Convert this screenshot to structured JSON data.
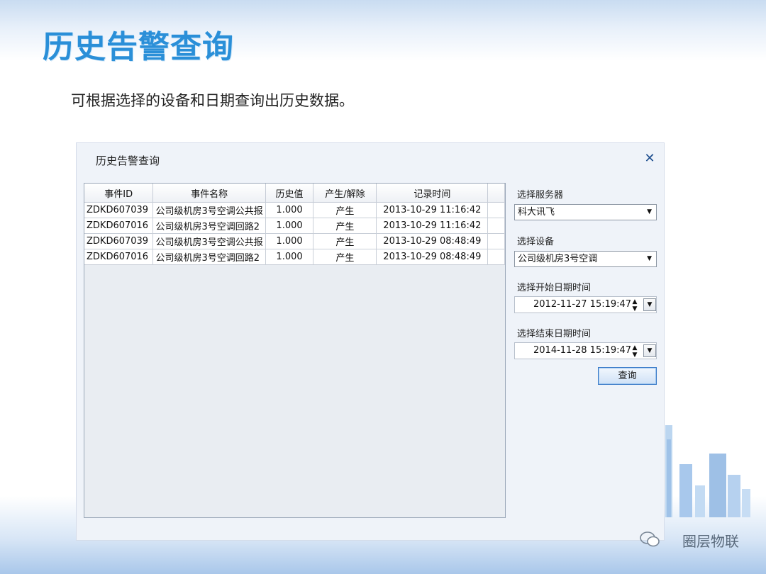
{
  "slide": {
    "title": "历史告警查询",
    "subtitle": "可根据选择的设备和日期查询出历史数据。"
  },
  "dialog": {
    "title": "历史告警查询",
    "close_glyph": "✕",
    "table": {
      "columns": [
        "事件ID",
        "事件名称",
        "历史值",
        "产生/解除",
        "记录时间"
      ],
      "rows": [
        [
          "ZDKD607039",
          "公司级机房3号空调公共报",
          "1.000",
          "产生",
          "2013-10-29 11:16:42"
        ],
        [
          "ZDKD607016",
          "公司级机房3号空调回路2",
          "1.000",
          "产生",
          "2013-10-29 11:16:42"
        ],
        [
          "ZDKD607039",
          "公司级机房3号空调公共报",
          "1.000",
          "产生",
          "2013-10-29 08:48:49"
        ],
        [
          "ZDKD607016",
          "公司级机房3号空调回路2",
          "1.000",
          "产生",
          "2013-10-29 08:48:49"
        ]
      ]
    },
    "panel": {
      "server_label": "选择服务器",
      "server_value": "科大讯飞",
      "device_label": "选择设备",
      "device_value": "公司级机房3号空调",
      "start_label": "选择开始日期时间",
      "start_value": "2012-11-27 15:19:47",
      "end_label": "选择结束日期时间",
      "end_value": "2014-11-28 15:19:47",
      "query_button": "查询"
    }
  },
  "brand": {
    "text": "圈层物联"
  },
  "colors": {
    "title": "#2a8fd8",
    "accent": "#3a7bc8"
  }
}
